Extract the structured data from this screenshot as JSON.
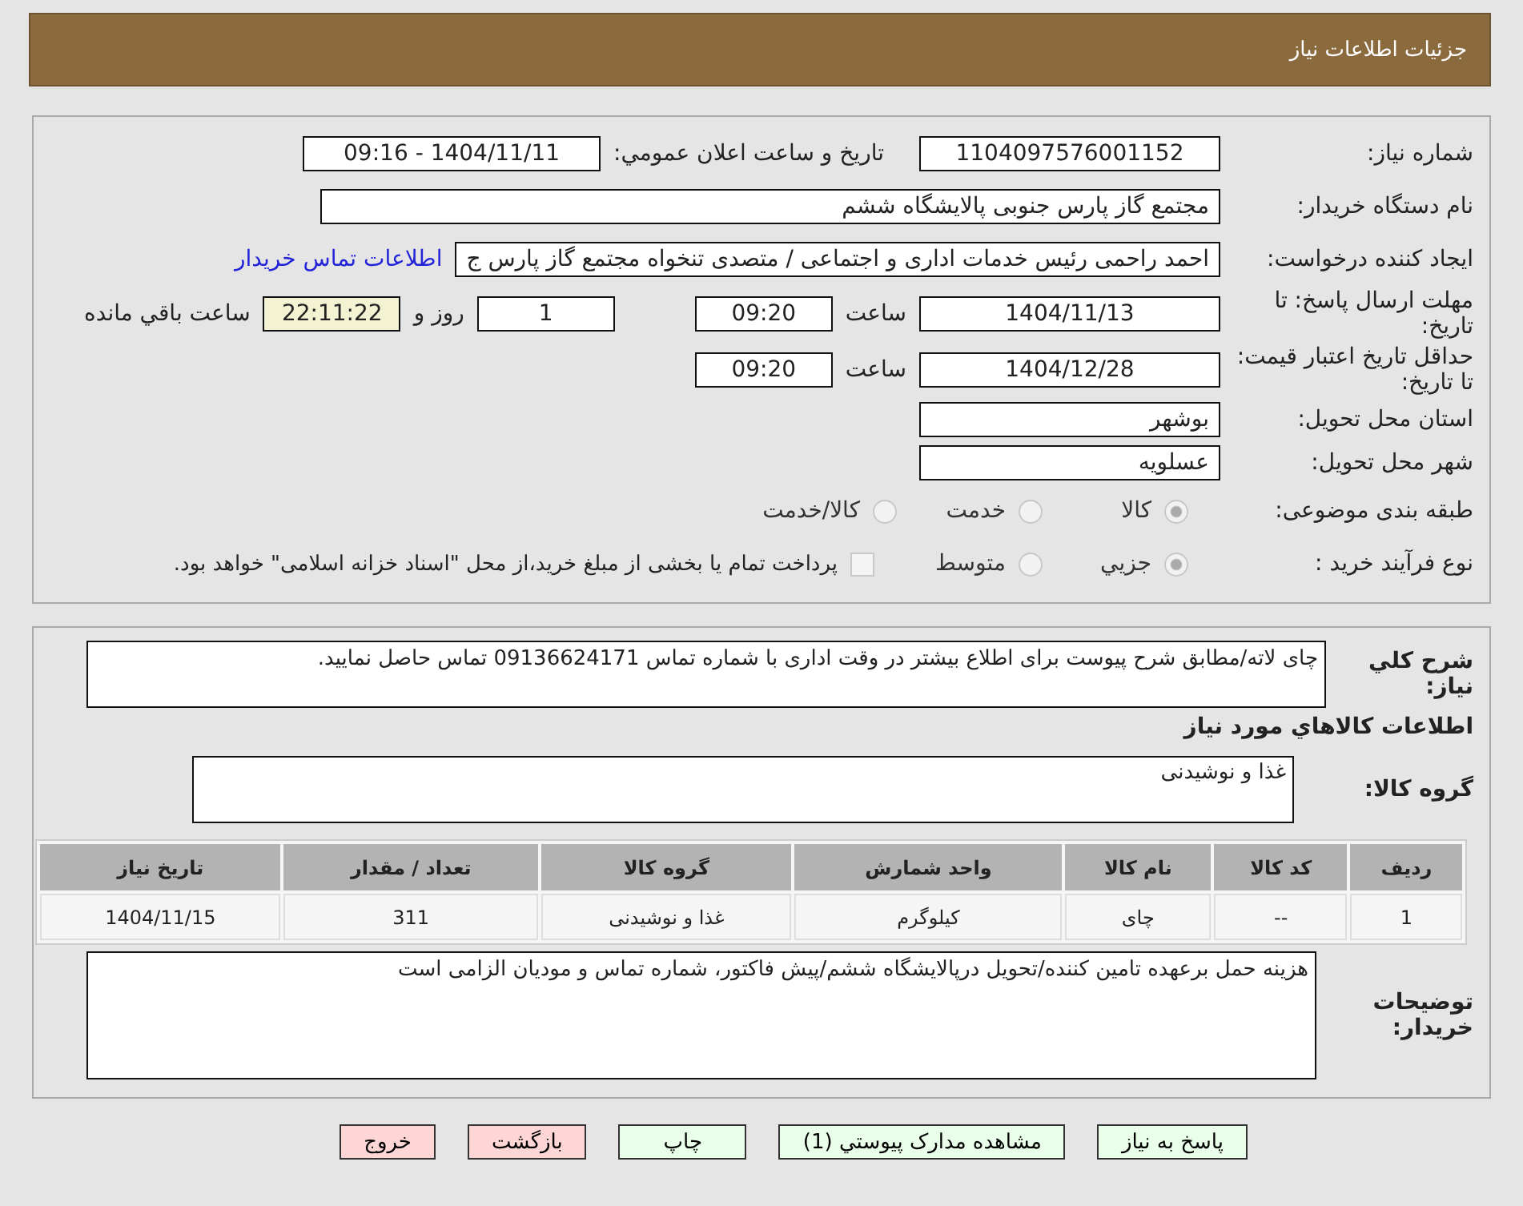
{
  "header": {
    "title": "جزئیات اطلاعات نیاز"
  },
  "form": {
    "need_number": {
      "label": "شماره نیاز:",
      "value": "1104097576001152"
    },
    "announce": {
      "label": "تاریخ و ساعت اعلان عمومي:",
      "value": "1404/11/11 - 09:16"
    },
    "buyer": {
      "label": "نام دستگاه خریدار:",
      "value": "مجتمع گاز پارس جنوبی  پالایشگاه ششم"
    },
    "requester": {
      "label": "ایجاد کننده درخواست:",
      "value": "احمد راحمی رئیس خدمات اداری و اجتماعی / متصدی تنخواه مجتمع گاز پارس ج",
      "link": "اطلاعات تماس خریدار"
    },
    "deadline": {
      "label": "مهلت ارسال پاسخ: تا تاریخ:",
      "date": "1404/11/13",
      "time_label": "ساعت",
      "time": "09:20",
      "days": "1",
      "days_label": "روز و",
      "remaining": "22:11:22",
      "remaining_label": "ساعت باقي مانده"
    },
    "validity": {
      "label": "حداقل تاریخ اعتبار قیمت: تا تاریخ:",
      "date": "1404/12/28",
      "time_label": "ساعت",
      "time": "09:20"
    },
    "province": {
      "label": "استان محل تحویل:",
      "value": "بوشهر"
    },
    "city": {
      "label": "شهر محل تحویل:",
      "value": "عسلویه"
    },
    "category": {
      "label": "طبقه بندی موضوعی:",
      "options": [
        {
          "label": "کالا",
          "selected": true
        },
        {
          "label": "خدمت",
          "selected": false
        },
        {
          "label": "کالا/خدمت",
          "selected": false
        }
      ]
    },
    "process": {
      "label": "نوع فرآیند خرید :",
      "options": [
        {
          "label": "جزيي",
          "selected": true
        },
        {
          "label": "متوسط",
          "selected": false
        }
      ],
      "treasury": {
        "label": "پرداخت تمام یا بخشی از مبلغ خرید،از محل \"اسناد خزانه اسلامی\" خواهد بود.",
        "checked": false
      }
    }
  },
  "details": {
    "description": {
      "label": "شرح کلي نیاز:",
      "value": "چای لاته/مطابق شرح پیوست برای اطلاع بیشتر در وقت اداری با شماره تماس 09136624171 تماس حاصل نمایید."
    },
    "goods_heading": "اطلاعات کالاهاي مورد نیاز",
    "group": {
      "label": "گروه کالا:",
      "value": "غذا و نوشیدنی"
    },
    "table": {
      "columns": [
        "ردیف",
        "کد کالا",
        "نام کالا",
        "واحد شمارش",
        "گروه کالا",
        "تعداد / مقدار",
        "تاریخ نیاز"
      ],
      "rows": [
        [
          "1",
          "--",
          "چای",
          "کیلوگرم",
          "غذا و نوشیدنی",
          "311",
          "1404/11/15"
        ]
      ]
    },
    "notes": {
      "label": "توضیحات خریدار:",
      "value": "هزینه حمل برعهده تامین کننده/تحویل درپالایشگاه ششم/پیش فاکتور، شماره تماس و مودیان الزامی است"
    }
  },
  "buttons": [
    {
      "label": "پاسخ به نیاز",
      "kind": "go"
    },
    {
      "label": "مشاهده مدارک پیوستي (1)",
      "kind": "go"
    },
    {
      "label": "چاپ",
      "kind": "go"
    },
    {
      "label": "بازگشت",
      "kind": "stop"
    },
    {
      "label": "خروج",
      "kind": "stop"
    }
  ]
}
